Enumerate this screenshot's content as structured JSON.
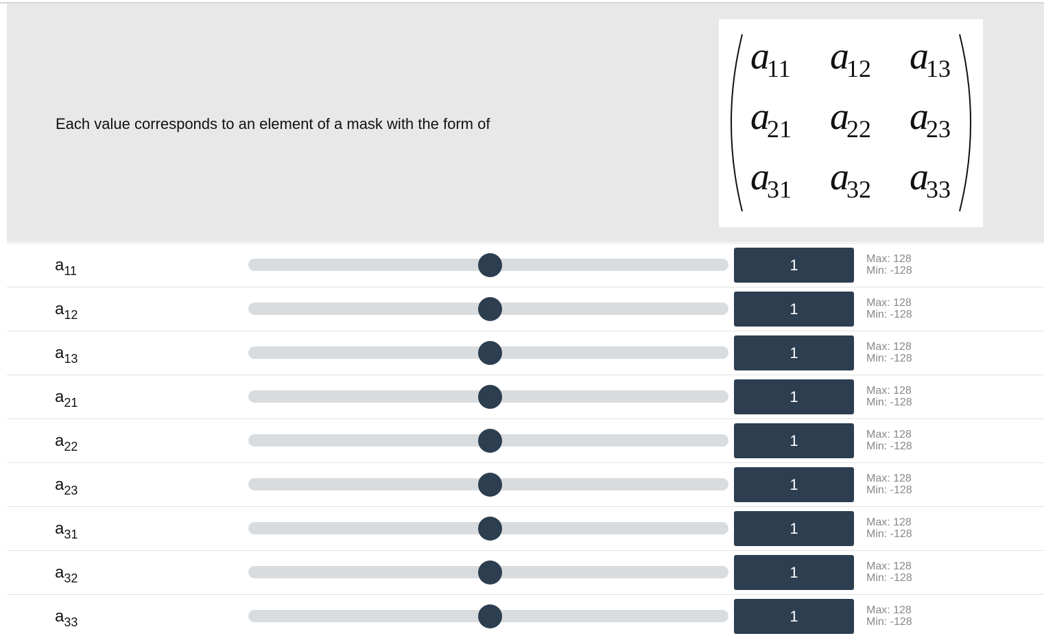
{
  "header": {
    "description": "Each value corresponds to an element of a mask with the form of",
    "matrix": [
      [
        {
          "base": "a",
          "sub": "11"
        },
        {
          "base": "a",
          "sub": "12"
        },
        {
          "base": "a",
          "sub": "13"
        }
      ],
      [
        {
          "base": "a",
          "sub": "21"
        },
        {
          "base": "a",
          "sub": "22"
        },
        {
          "base": "a",
          "sub": "23"
        }
      ],
      [
        {
          "base": "a",
          "sub": "31"
        },
        {
          "base": "a",
          "sub": "32"
        },
        {
          "base": "a",
          "sub": "33"
        }
      ]
    ]
  },
  "colors": {
    "header_bg": "#e8e8e8",
    "accent": "#2c3e50",
    "track": "#d9dcde",
    "limit_text": "#888888"
  },
  "sliders": [
    {
      "label": "a",
      "sub": "11",
      "value": "1",
      "max_label": "Max: 128",
      "min_label": "Min: -128",
      "min": -128,
      "max": 128
    },
    {
      "label": "a",
      "sub": "12",
      "value": "1",
      "max_label": "Max: 128",
      "min_label": "Min: -128",
      "min": -128,
      "max": 128
    },
    {
      "label": "a",
      "sub": "13",
      "value": "1",
      "max_label": "Max: 128",
      "min_label": "Min: -128",
      "min": -128,
      "max": 128
    },
    {
      "label": "a",
      "sub": "21",
      "value": "1",
      "max_label": "Max: 128",
      "min_label": "Min: -128",
      "min": -128,
      "max": 128
    },
    {
      "label": "a",
      "sub": "22",
      "value": "1",
      "max_label": "Max: 128",
      "min_label": "Min: -128",
      "min": -128,
      "max": 128
    },
    {
      "label": "a",
      "sub": "23",
      "value": "1",
      "max_label": "Max: 128",
      "min_label": "Min: -128",
      "min": -128,
      "max": 128
    },
    {
      "label": "a",
      "sub": "31",
      "value": "1",
      "max_label": "Max: 128",
      "min_label": "Min: -128",
      "min": -128,
      "max": 128
    },
    {
      "label": "a",
      "sub": "32",
      "value": "1",
      "max_label": "Max: 128",
      "min_label": "Min: -128",
      "min": -128,
      "max": 128
    },
    {
      "label": "a",
      "sub": "33",
      "value": "1",
      "max_label": "Max: 128",
      "min_label": "Min: -128",
      "min": -128,
      "max": 128
    }
  ]
}
